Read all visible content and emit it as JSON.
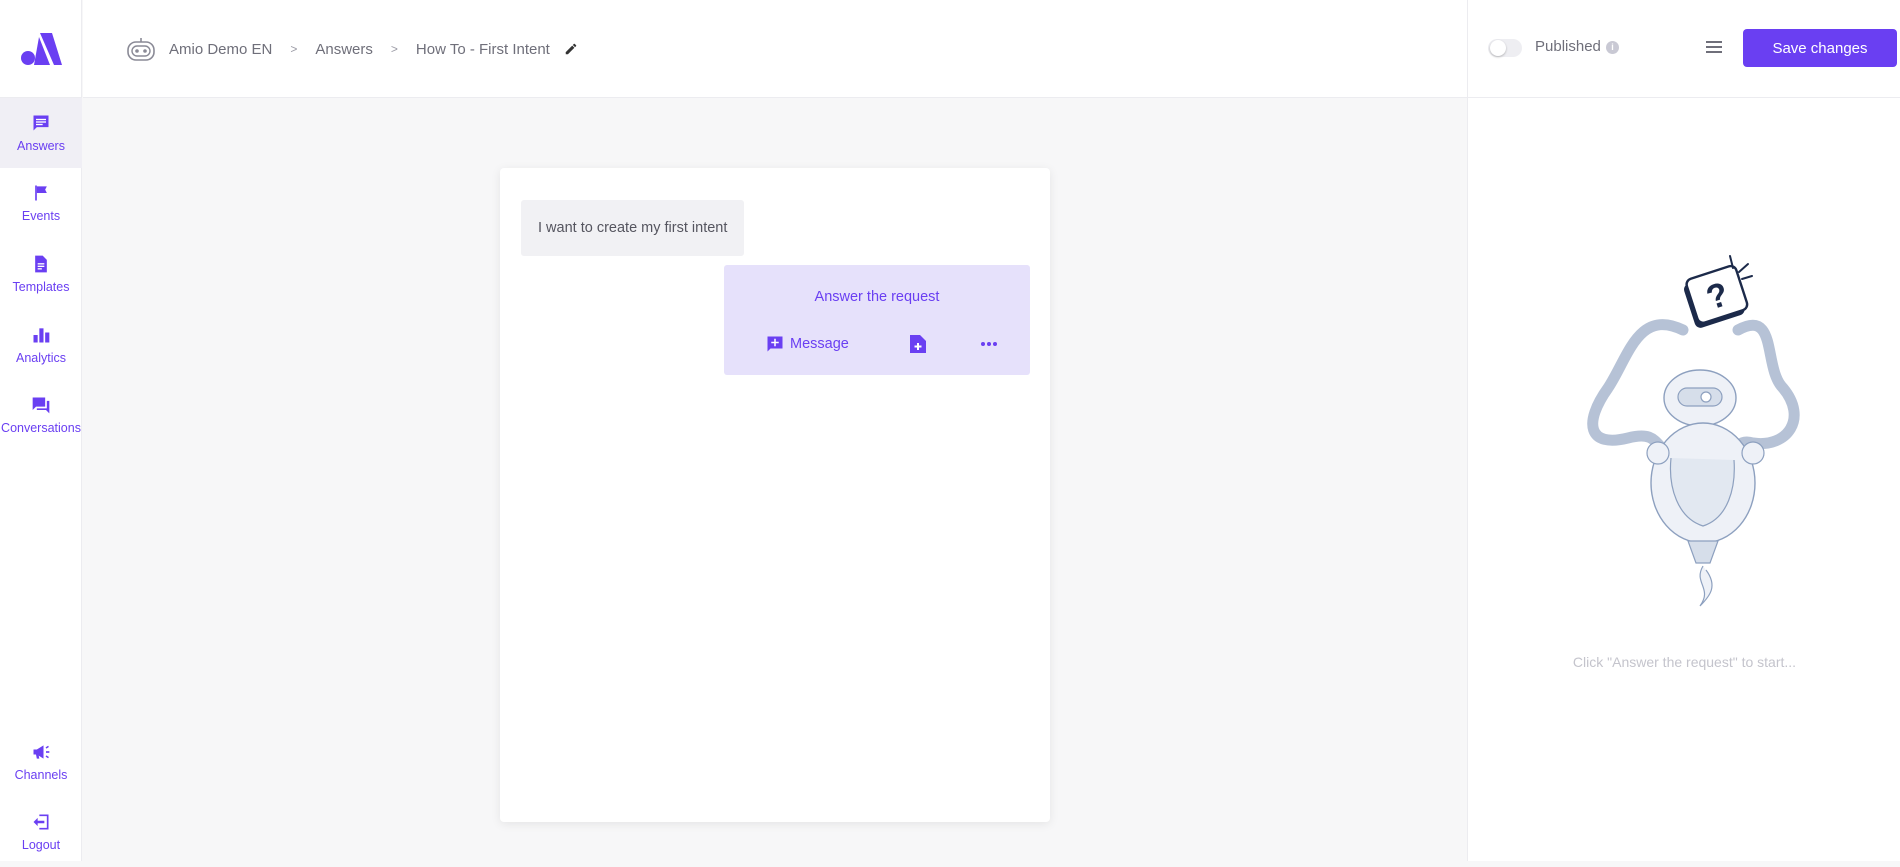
{
  "sidebar": {
    "items": [
      {
        "label": "Answers",
        "icon": "chat-icon"
      },
      {
        "label": "Events",
        "icon": "flag-icon"
      },
      {
        "label": "Templates",
        "icon": "document-icon"
      },
      {
        "label": "Analytics",
        "icon": "bar-chart-icon"
      },
      {
        "label": "Conversations",
        "icon": "forum-icon"
      }
    ],
    "bottom_items": [
      {
        "label": "Channels",
        "icon": "megaphone-icon"
      },
      {
        "label": "Logout",
        "icon": "logout-icon"
      }
    ]
  },
  "breadcrumb": {
    "bot": "Amio Demo EN",
    "section": "Answers",
    "page": "How To - First Intent",
    "separator": ">"
  },
  "header": {
    "published_label": "Published",
    "published": false,
    "save_label": "Save changes"
  },
  "conversation": {
    "user_message": "I want to create my first intent",
    "answer_title": "Answer the request",
    "message_button": "Message"
  },
  "right_panel": {
    "hint": "Click \"Answer the request\" to start..."
  },
  "colors": {
    "accent": "#6a3ff2",
    "answer_bg": "#e6e1fb",
    "page_bg": "#f7f7f8"
  }
}
